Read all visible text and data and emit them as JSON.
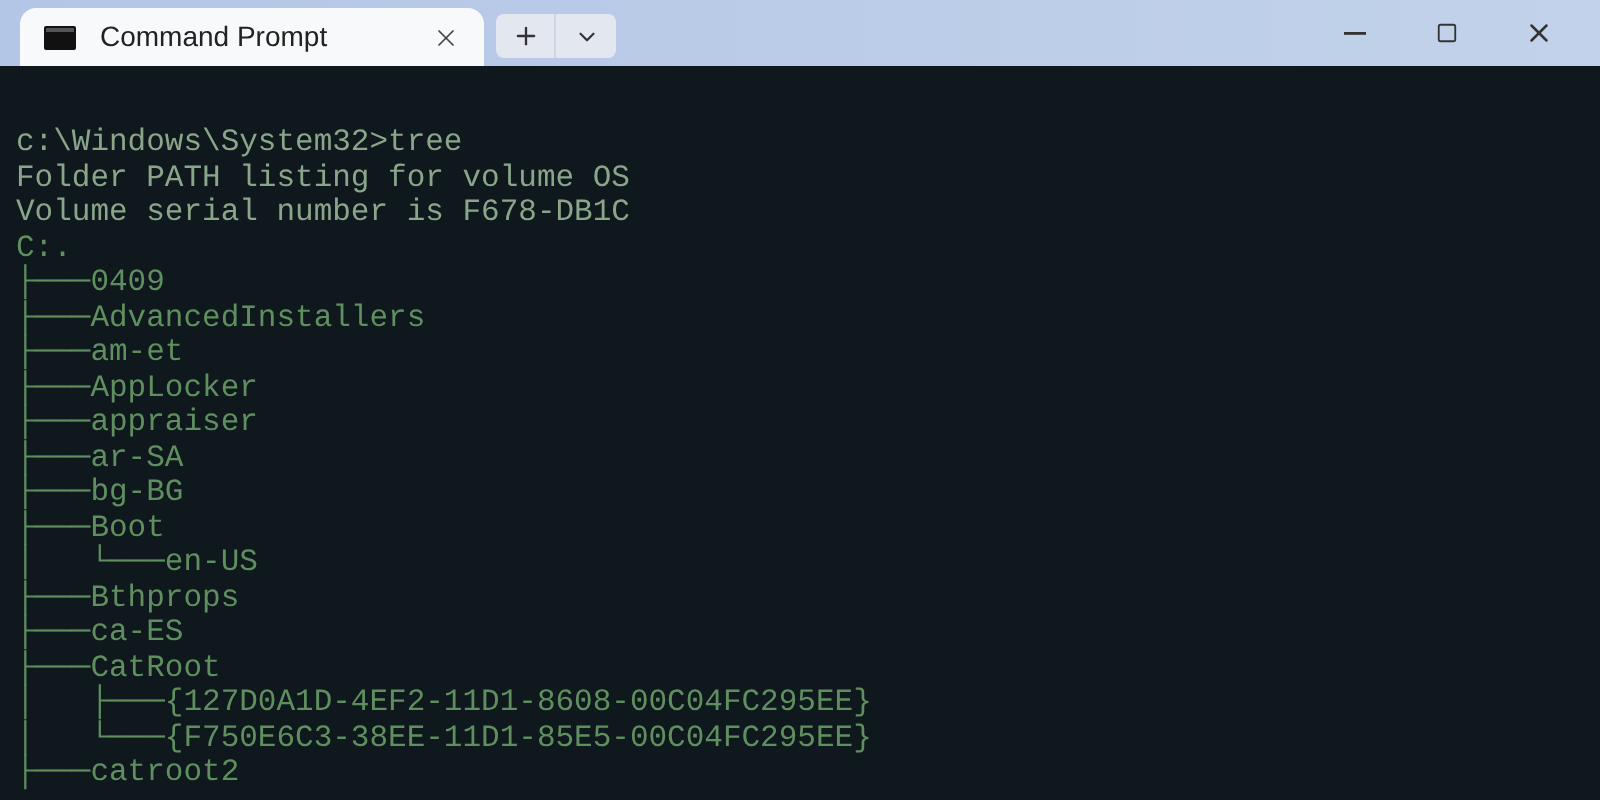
{
  "window": {
    "tab": {
      "title": "Command Prompt",
      "selected": true
    }
  },
  "terminal": {
    "lines": [
      "c:\\Windows\\System32>tree",
      "Folder PATH listing for volume OS",
      "Volume serial number is F678-DB1C",
      "C:.",
      "├───0409",
      "├───AdvancedInstallers",
      "├───am-et",
      "├───AppLocker",
      "├───appraiser",
      "├───ar-SA",
      "├───bg-BG",
      "├───Boot",
      "│   └───en-US",
      "├───Bthprops",
      "├───ca-ES",
      "├───CatRoot",
      "│   ├───{127D0A1D-4EF2-11D1-8608-00C04FC295EE}",
      "│   └───{F750E6C3-38EE-11D1-85E5-00C04FC295EE}",
      "├───catroot2"
    ]
  }
}
